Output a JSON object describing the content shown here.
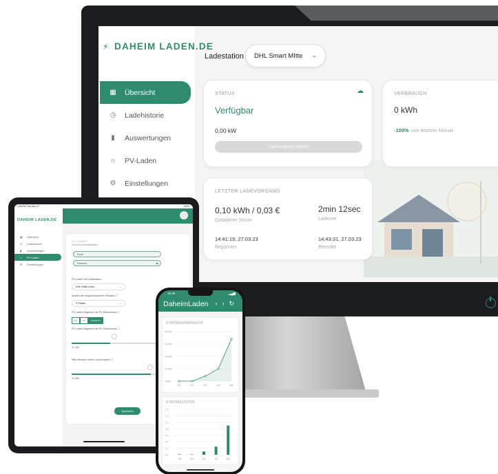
{
  "colors": {
    "accent": "#2e8b6e",
    "frame": "#1c1d1f"
  },
  "desktop": {
    "brand": "DAHEIM LADEN.DE",
    "nav": [
      {
        "label": "Übersicht",
        "icon": "grid-icon",
        "active": true
      },
      {
        "label": "Ladehistorie",
        "icon": "history-icon",
        "active": false
      },
      {
        "label": "Auswertungen",
        "icon": "bar-chart-icon",
        "active": false
      },
      {
        "label": "PV-Laden",
        "icon": "sun-icon",
        "active": false
      },
      {
        "label": "Einstellungen",
        "icon": "gear-icon",
        "active": false
      }
    ],
    "ladestation_label": "Ladestation",
    "ladestation_value": "DHL Smart MItte",
    "status": {
      "heading": "STATUS",
      "value": "Verfügbar",
      "power": "0,00 kW",
      "button": "Ladevorgang starten"
    },
    "verbrauch": {
      "heading": "VERBRAUCH",
      "value": "0 kWh",
      "change": "-100%",
      "change_sub": "seit letztem Monat"
    },
    "letzter": {
      "heading": "LETZTER LADEVORGANG",
      "energy": "0,10 kWh / 0,03 €",
      "energy_sub": "Geladener Strom",
      "duration": "2min 12sec",
      "duration_sub": "Ladezeit",
      "start_time": "14:41:19, 27.03.23",
      "start_sub": "Begonnen",
      "end_time": "14:43:31, 27.03.23",
      "end_sub": "Beendet"
    }
  },
  "tablet": {
    "statusbar_left": "1:58 PM   Tue Dec 27",
    "statusbar_right": "100%",
    "brand": "DAHEIM LADEN.DE",
    "nav": [
      {
        "label": "Übersicht",
        "icon": "grid-icon"
      },
      {
        "label": "Ladehistorie",
        "icon": "history-icon"
      },
      {
        "label": "Auswertungen",
        "icon": "bar-chart-icon"
      },
      {
        "label": "PV-Laden",
        "icon": "sun-icon"
      },
      {
        "label": "Einstellungen",
        "icon": "gear-icon"
      }
    ],
    "panel": {
      "heading": "PV-LADEN",
      "sub": "Powerfox Anmeldedaten",
      "email_placeholder": "Email",
      "password_placeholder": "Passwort",
      "station_label": "PV-Laden mit Ladestation",
      "station_value": "DHL MItte Links",
      "phases_label": "Anzahl der angeschlossenen Phasen",
      "phases_value": "3 Phase",
      "start_label": "PV Laden beginnen ab PV-Überschuss",
      "seg": [
        "aus",
        "PV",
        "anteilig PV"
      ],
      "threshold_label": "PV Laden beginnen ab PV Überschuss",
      "threshold_value": "0,1 kW",
      "max_label": "Max Allowed Home Consumption",
      "max_value": "0,1 kW",
      "save": "Speichern"
    }
  },
  "phone": {
    "time": "12:49",
    "title": "DaheimLaden",
    "nav_prev": "‹",
    "nav_next": "›",
    "nav_refresh": "↻",
    "card1_title": "STROMVERBRAUCH",
    "card2_title": "STROMKOSTEN",
    "tick_labels_line": [
      "0 kWh",
      "10 kWh",
      "20 kWh",
      "30 kWh",
      "40 kWh"
    ],
    "tick_labels_bar": [
      "0.0",
      "0.2",
      "0.4",
      "0.6",
      "0.8",
      "1.0",
      "1.2",
      "1.4"
    ],
    "x_labels": [
      "Okt",
      "Nov",
      "Dec",
      "Jan",
      "Mar"
    ]
  },
  "chart_data": [
    {
      "type": "line",
      "title": "STROMVERBRAUCH",
      "categories": [
        "Okt",
        "Nov",
        "Dec",
        "Jan",
        "Mar"
      ],
      "values": [
        0,
        0,
        4,
        10,
        34
      ],
      "ylim": [
        0,
        40
      ]
    },
    {
      "type": "bar",
      "title": "STROMKOSTEN",
      "categories": [
        "Okt",
        "Nov",
        "Dec",
        "Jan",
        "Mar"
      ],
      "values": [
        0,
        0,
        0.1,
        0.25,
        0.9
      ],
      "ylim": [
        0,
        1.4
      ]
    }
  ]
}
